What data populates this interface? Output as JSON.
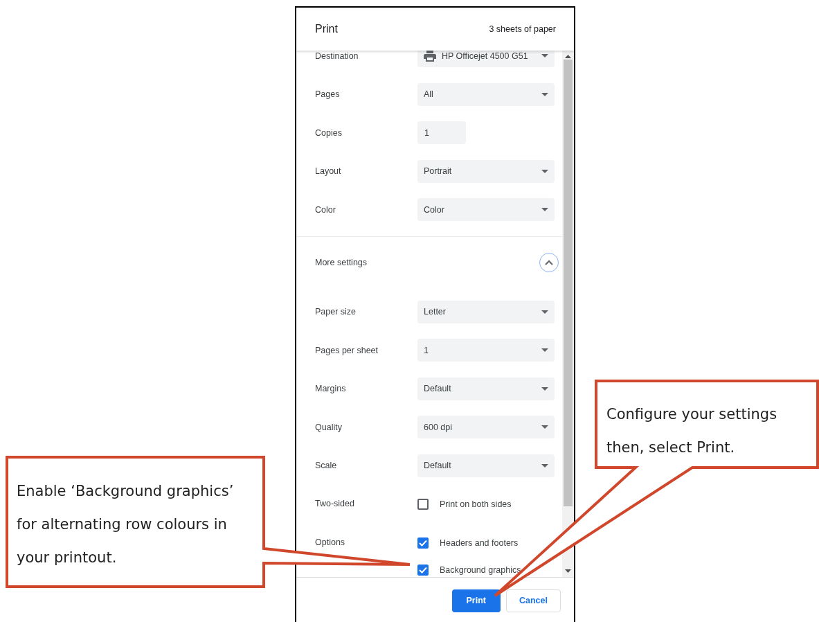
{
  "dialog": {
    "title": "Print",
    "sheets": "3 sheets of paper",
    "settings": [
      {
        "label": "Destination",
        "kind": "printer",
        "value": "HP Officejet 4500 G51"
      },
      {
        "label": "Pages",
        "kind": "select",
        "value": "All"
      },
      {
        "label": "Copies",
        "kind": "input",
        "value": "1"
      },
      {
        "label": "Layout",
        "kind": "select",
        "value": "Portrait"
      },
      {
        "label": "Color",
        "kind": "select",
        "value": "Color"
      }
    ],
    "more_settings": {
      "label": "More settings",
      "expanded": true
    },
    "advanced": [
      {
        "label": "Paper size",
        "kind": "select",
        "value": "Letter"
      },
      {
        "label": "Pages per sheet",
        "kind": "select",
        "value": "1"
      },
      {
        "label": "Margins",
        "kind": "select",
        "value": "Default"
      },
      {
        "label": "Quality",
        "kind": "select",
        "value": "600 dpi"
      },
      {
        "label": "Scale",
        "kind": "select",
        "value": "Default"
      },
      {
        "label": "Two-sided",
        "kind": "checkboxes",
        "options": [
          {
            "label": "Print on both sides",
            "checked": false
          }
        ]
      },
      {
        "label": "Options",
        "kind": "checkboxes",
        "options": [
          {
            "label": "Headers and footers",
            "checked": true
          },
          {
            "label": "Background graphics",
            "checked": true
          }
        ]
      }
    ],
    "buttons": [
      {
        "label": "Print",
        "kind": "primary"
      },
      {
        "label": "Cancel",
        "kind": "secondary"
      }
    ]
  },
  "callouts": [
    {
      "text": "Enable ‘Background graphics’ for alternating row colours in your printout."
    },
    {
      "text": "Configure your settings then, select Print."
    }
  ]
}
